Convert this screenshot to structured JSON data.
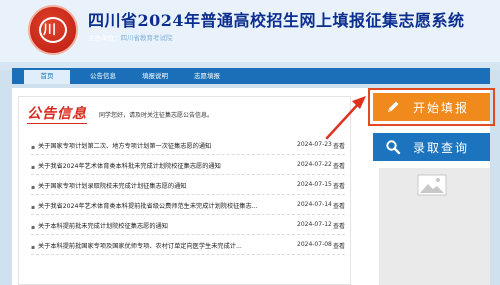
{
  "header": {
    "title": "四川省2024年普通高校招生网上填报征集志愿系统",
    "subtitle_label": "主办单位：",
    "subtitle_host": "四川省教育考试院"
  },
  "nav": {
    "items": [
      {
        "label": "首页",
        "active": true
      },
      {
        "label": "公告信息",
        "active": false
      },
      {
        "label": "填报说明",
        "active": false
      },
      {
        "label": "志愿填报",
        "active": false
      }
    ]
  },
  "notice": {
    "title": "公告信息",
    "hint": "同学您好，请及时关注征集志愿公告信息。",
    "items": [
      {
        "title": "关于国家专项计划第二次、地方专项计划第一次征集志愿的通知",
        "date": "2024-07-23",
        "action": "查看"
      },
      {
        "title": "关于我省2024年艺术体育类本科批未完成计划院校征集志愿的通知",
        "date": "2024-07-22",
        "action": "查看"
      },
      {
        "title": "关于国家专项计划录取院校未完成计划征集志愿的通知",
        "date": "2024-07-15",
        "action": "查看"
      },
      {
        "title": "关于我省2024年艺术体育类本科提前批省级公费师范生未完成计划院校征集志...",
        "date": "2024-07-14",
        "action": "查看"
      },
      {
        "title": "关于本科提前批未完成计划院校征集志愿的通知",
        "date": "2024-07-12",
        "action": "查看"
      },
      {
        "title": "关于本科提前批国家专项及国家优师专项、农村订单定向医学生未完成计...",
        "date": "2024-07-08",
        "action": "查看"
      }
    ]
  },
  "side": {
    "start_label": "开始填报",
    "query_label": "录取查询"
  },
  "colors": {
    "brand_blue": "#1a6fb8",
    "accent_orange": "#f18a1c",
    "title_red": "#d82a1e",
    "arrow_red": "#e0301e"
  }
}
